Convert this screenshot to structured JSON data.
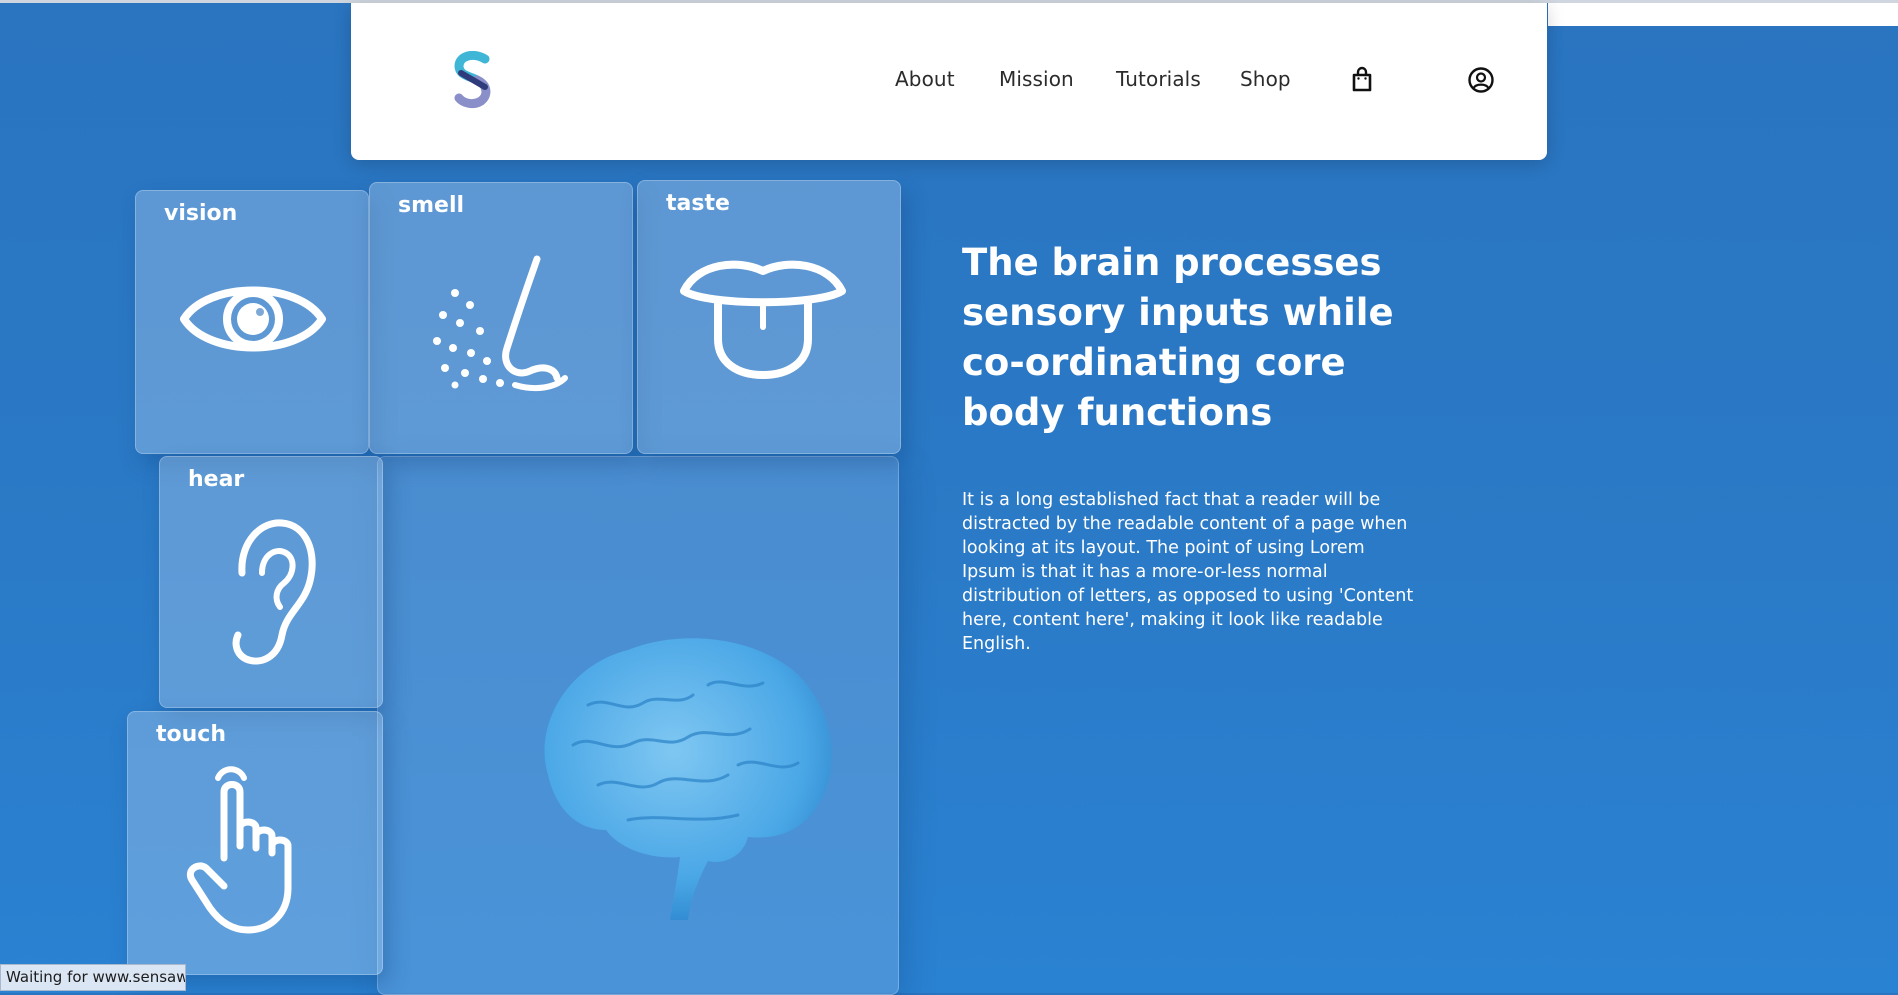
{
  "nav": {
    "links": [
      "About",
      "Mission",
      "Tutorials",
      "Shop"
    ],
    "cart_icon": "shopping-bag-icon",
    "account_icon": "user-circle-icon"
  },
  "senses": {
    "vision": "vision",
    "smell": "smell",
    "taste": "taste",
    "hear": "hear",
    "touch": "touch"
  },
  "hero": {
    "headline": "The brain processes sensory inputs while co-ordinating core body functions",
    "body": "It is a long established fact that a reader will be distracted by the readable content of a page when looking at its layout. The point of using Lorem Ipsum is that it has a more-or-less normal distribution of letters, as opposed to using 'Content here, content here', making it look like readable English."
  },
  "status": {
    "text": "Waiting for www.sensaw..."
  },
  "colors": {
    "background": "#2a74c0",
    "navbar": "#ffffff",
    "text_light": "#ffffff",
    "brain": "#5fb3ea"
  }
}
